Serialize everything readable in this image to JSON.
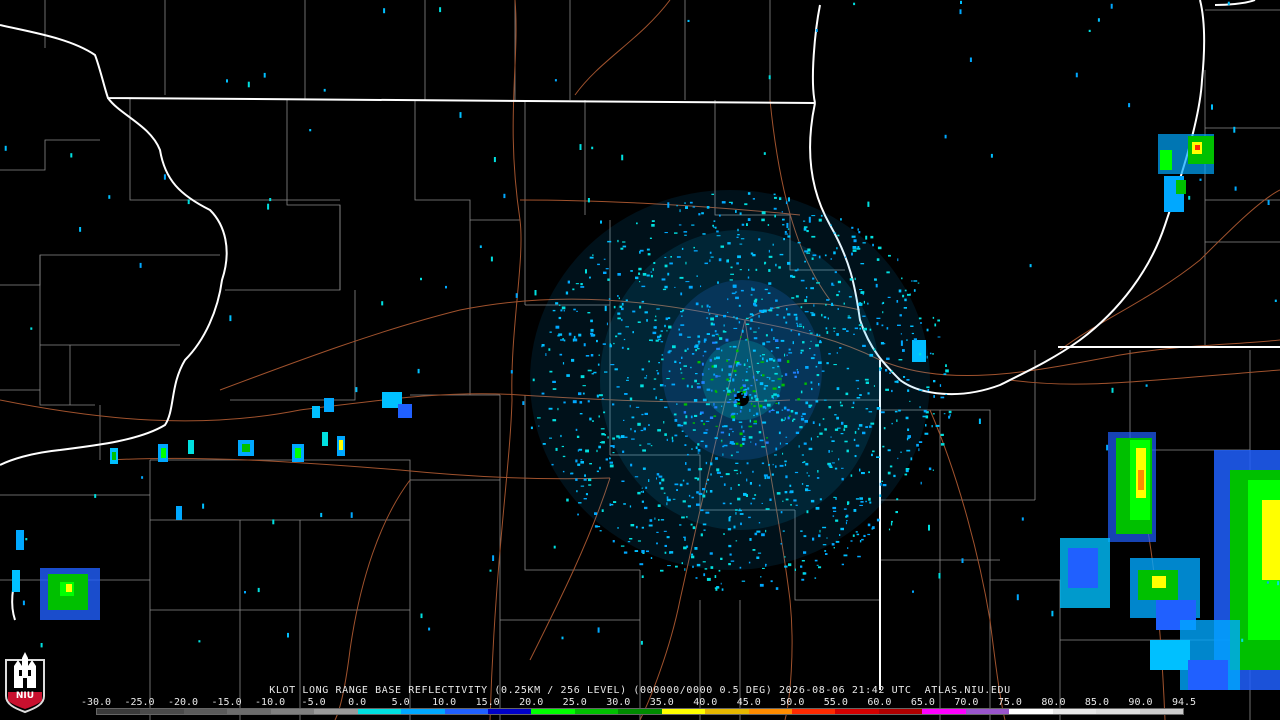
{
  "caption": {
    "text": "KLOT LONG RANGE BASE REFLECTIVITY (0.25KM / 256 LEVEL) (000000/0000 0.5 DEG) 2026-08-06 21:42 UTC  ATLAS.NIU.EDU"
  },
  "scale": {
    "ticks": [
      "-30.0",
      "-25.0",
      "-20.0",
      "-15.0",
      "-10.0",
      "-5.0",
      "0.0",
      "5.0",
      "10.0",
      "15.0",
      "20.0",
      "25.0",
      "30.0",
      "35.0",
      "40.0",
      "45.0",
      "50.0",
      "55.0",
      "60.0",
      "65.0",
      "70.0",
      "75.0",
      "80.0",
      "85.0",
      "90.0",
      "94.5"
    ],
    "colors": [
      "#3a3a3a",
      "#4a4a4a",
      "#5a5a5a",
      "#6c6c6c",
      "#808080",
      "#9a9a9a",
      "#00e0e0",
      "#00a8ff",
      "#2060ff",
      "#0000c8",
      "#00ff00",
      "#00c000",
      "#008c00",
      "#ffff00",
      "#e6b800",
      "#ff8c00",
      "#ff2a00",
      "#d40000",
      "#b00000",
      "#ff00ff",
      "#9955cc",
      "#ffffff",
      "#e8e8e8",
      "#dddddd",
      "#cccccc"
    ]
  },
  "logo": {
    "text": "NIU",
    "brand_color": "#c8102e"
  },
  "map": {
    "radar_site": "KLOT",
    "state_line_color": "#ffffff",
    "county_line_color": "#8a8a8a",
    "highway_color": "#a0522d"
  }
}
